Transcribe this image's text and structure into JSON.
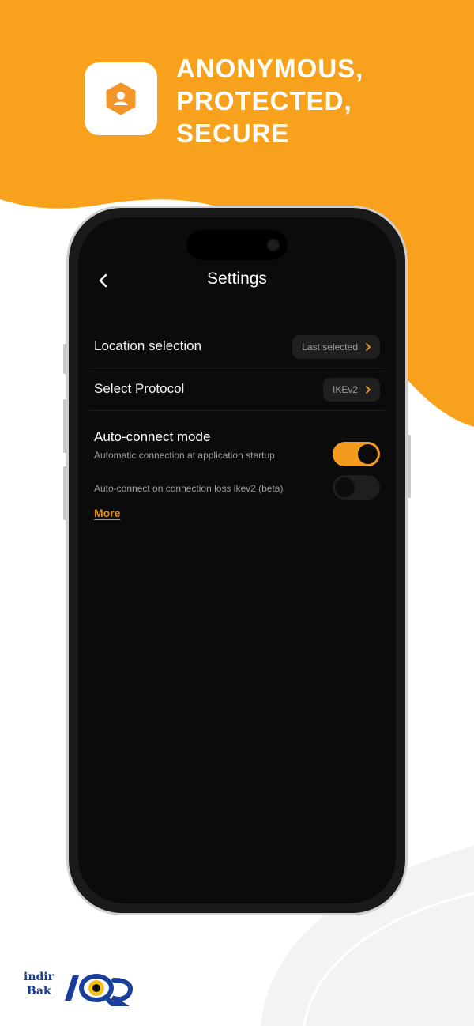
{
  "colors": {
    "accent": "#F49A1C",
    "screen_bg": "#0B0B0B",
    "logo_blue": "#1A3F99"
  },
  "banner": {
    "icon": "user-hexagon-icon",
    "headline": [
      "ANONYMOUS,",
      "PROTECTED,",
      "SECURE"
    ]
  },
  "settings": {
    "title": "Settings",
    "back_icon": "chevron-left-icon",
    "rows": [
      {
        "label": "Location selection",
        "value": "Last selected",
        "icon": "chevron-right-icon"
      },
      {
        "label": "Select Protocol",
        "value": "IKEv2",
        "icon": "chevron-right-icon"
      }
    ],
    "auto_connect": {
      "title": "Auto-connect mode",
      "options": [
        {
          "label": "Automatic connection at application startup",
          "enabled": true
        },
        {
          "label": "Auto-connect on connection loss ikev2 (beta)",
          "enabled": false
        }
      ],
      "more_link": "More"
    }
  },
  "watermark": {
    "line1": "indir",
    "line2": "Bak",
    "mark_icon": "eye-logo-icon"
  }
}
